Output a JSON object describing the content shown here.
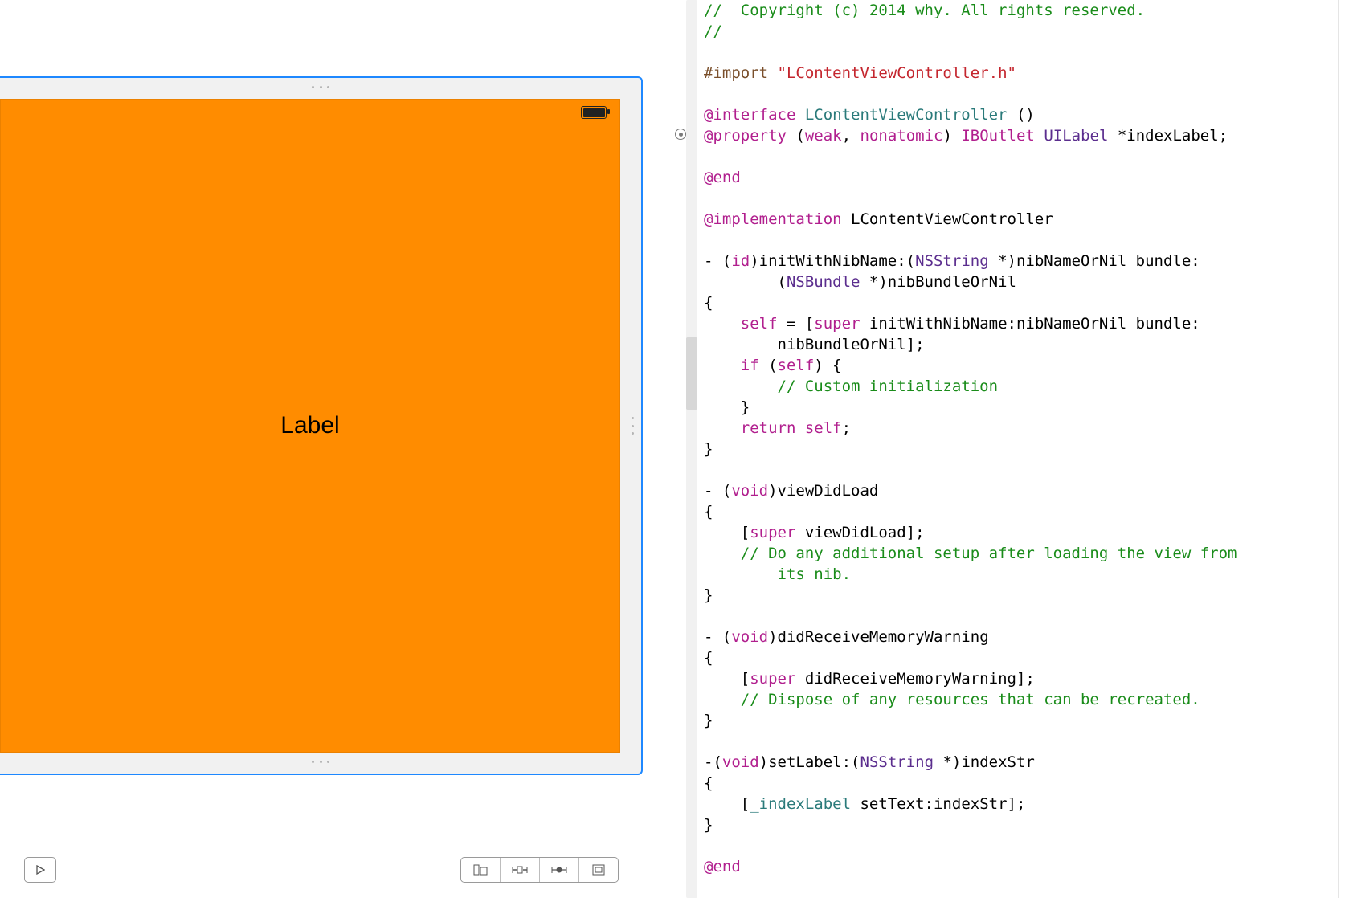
{
  "ib": {
    "center_label": "Label"
  },
  "code": {
    "l1": "//  Copyright (c) 2014 why. All rights reserved.",
    "l2": "//",
    "imp1": "#import",
    "imp2": "\"LContentViewController.h\"",
    "kw_interface": "@interface",
    "cls": "LContentViewController",
    "iface_tail": " ()",
    "kw_property": "@property",
    "prop_attrs": " (",
    "weak": "weak",
    "comma": ", ",
    "nonatomic": "nonatomic",
    "prop_close": ") ",
    "iboutlet": "IBOutlet",
    "uilabel": "UILabel",
    "star_idx": " *indexLabel;",
    "kw_end1": "@end",
    "kw_impl": "@implementation",
    "impl_cls": " LContentViewController",
    "m1a": "- (",
    "id": "id",
    "m1b": ")initWithNibName:(",
    "nsstring": "NSString",
    "m1c": " *)nibNameOrNil bundle:",
    "m1d": "        (",
    "nsbundle": "NSBundle",
    "m1e": " *)nibBundleOrNil",
    "brace_o": "{",
    "m1f": "    ",
    "self1": "self",
    "m1g": " = [",
    "super1": "super",
    "m1h": " initWithNibName:nibNameOrNil bundle:",
    "m1i": "        nibBundleOrNil];",
    "if": "    if",
    "m1j": " (",
    "self2": "self",
    "m1k": ") {",
    "m1l": "        // Custom initialization",
    "m1m": "    }",
    "ret": "    return",
    "self3": " self",
    "semi": ";",
    "brace_c": "}",
    "m2a": "- (",
    "void": "void",
    "m2b": ")viewDidLoad",
    "m2c": "    [",
    "super2": "super",
    "m2d": " viewDidLoad];",
    "m2e": "    // Do any additional setup after loading the view from",
    "m2f": "        its nib.",
    "m3b": ")didReceiveMemoryWarning",
    "m3c": "    [",
    "super3": "super",
    "m3d": " didReceiveMemoryWarning];",
    "m3e": "    // Dispose of any resources that can be recreated.",
    "m4a": "-(",
    "m4b": ")setLabel:(",
    "m4c": " *)indexStr",
    "m4d": "    [",
    "idxlabel": "_indexLabel",
    "m4e": " setText:indexStr];",
    "kw_end2": "@end"
  }
}
